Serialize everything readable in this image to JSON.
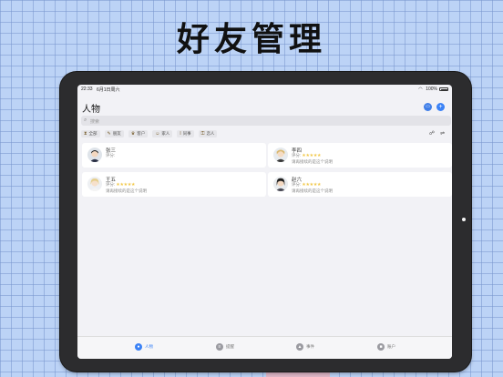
{
  "headline": "好友管理",
  "status": {
    "time": "22:33",
    "date": "6月1日周六",
    "battery": "100%"
  },
  "header": {
    "title": "人物"
  },
  "search": {
    "placeholder": "搜索"
  },
  "filters": [
    {
      "label": "全部",
      "icon": "hourglass-icon"
    },
    {
      "label": "朋友",
      "icon": "pencil-icon"
    },
    {
      "label": "客户",
      "icon": "trophy-icon"
    },
    {
      "label": "家人",
      "icon": "family-icon"
    },
    {
      "label": "同事",
      "icon": "candle-icon"
    },
    {
      "label": "恋人",
      "icon": "lock-icon"
    }
  ],
  "people": [
    {
      "name": "张三",
      "rating_label": "评分:",
      "rating": 0,
      "stars": "",
      "note": ""
    },
    {
      "name": "李四",
      "rating_label": "评分:",
      "rating": 5,
      "stars": "★★★★★",
      "note": "请再接续的是这个说明"
    },
    {
      "name": "王五",
      "rating_label": "评分:",
      "rating": 5,
      "stars": "★★★★★",
      "note": "请再接续的是这个说明"
    },
    {
      "name": "赵六",
      "rating_label": "评分:",
      "rating": 5,
      "stars": "★★★★★",
      "note": "请再接续的是这个说明"
    }
  ],
  "tabs": [
    {
      "label": "人物",
      "active": true
    },
    {
      "label": "提醒",
      "active": false
    },
    {
      "label": "事件",
      "active": false
    },
    {
      "label": "账户",
      "active": false
    }
  ],
  "colors": {
    "accent": "#3b82f6",
    "star": "#f2c94c",
    "bezel": "#2c2c2e",
    "background": "#bcd3f6"
  }
}
